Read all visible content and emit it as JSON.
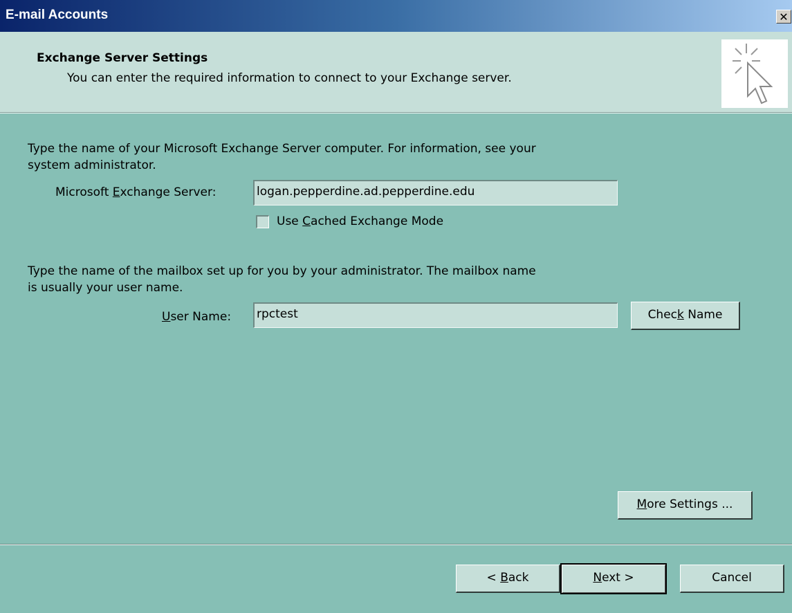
{
  "window": {
    "title": "E-mail Accounts",
    "close_label": "✕"
  },
  "header": {
    "title": "Exchange Server Settings",
    "subtitle": "You can enter the required information to connect to your Exchange server.",
    "icon": "cursor-sparkle-icon"
  },
  "server_section": {
    "instruction_line1": "Type the name of your Microsoft Exchange Server computer. For information, see your",
    "instruction_line2": "system administrator.",
    "server_label_pre": "Microsoft ",
    "server_label_key": "E",
    "server_label_post": "xchange Server:",
    "server_value": "logan.pepperdine.ad.pepperdine.edu",
    "cached_pre": "Use ",
    "cached_key": "C",
    "cached_post": "ached Exchange Mode",
    "cached_checked": false
  },
  "user_section": {
    "instruction_line1": "Type the name of the mailbox set up for you by your administrator. The mailbox name",
    "instruction_line2": "is usually your user name.",
    "user_label_key": "U",
    "user_label_post": "ser Name:",
    "user_value": "rpctest",
    "check_name_pre": "Chec",
    "check_name_key": "k",
    "check_name_post": " Name"
  },
  "more_settings": {
    "key": "M",
    "post": "ore Settings ..."
  },
  "footer": {
    "back_pre": "< ",
    "back_key": "B",
    "back_post": "ack",
    "next_key": "N",
    "next_post": "ext >",
    "cancel_label": "Cancel"
  },
  "colors": {
    "background": "#86bfb5",
    "panel": "#c6dfd9",
    "titlebar_start": "#0a246a",
    "titlebar_end": "#a6caf0"
  }
}
